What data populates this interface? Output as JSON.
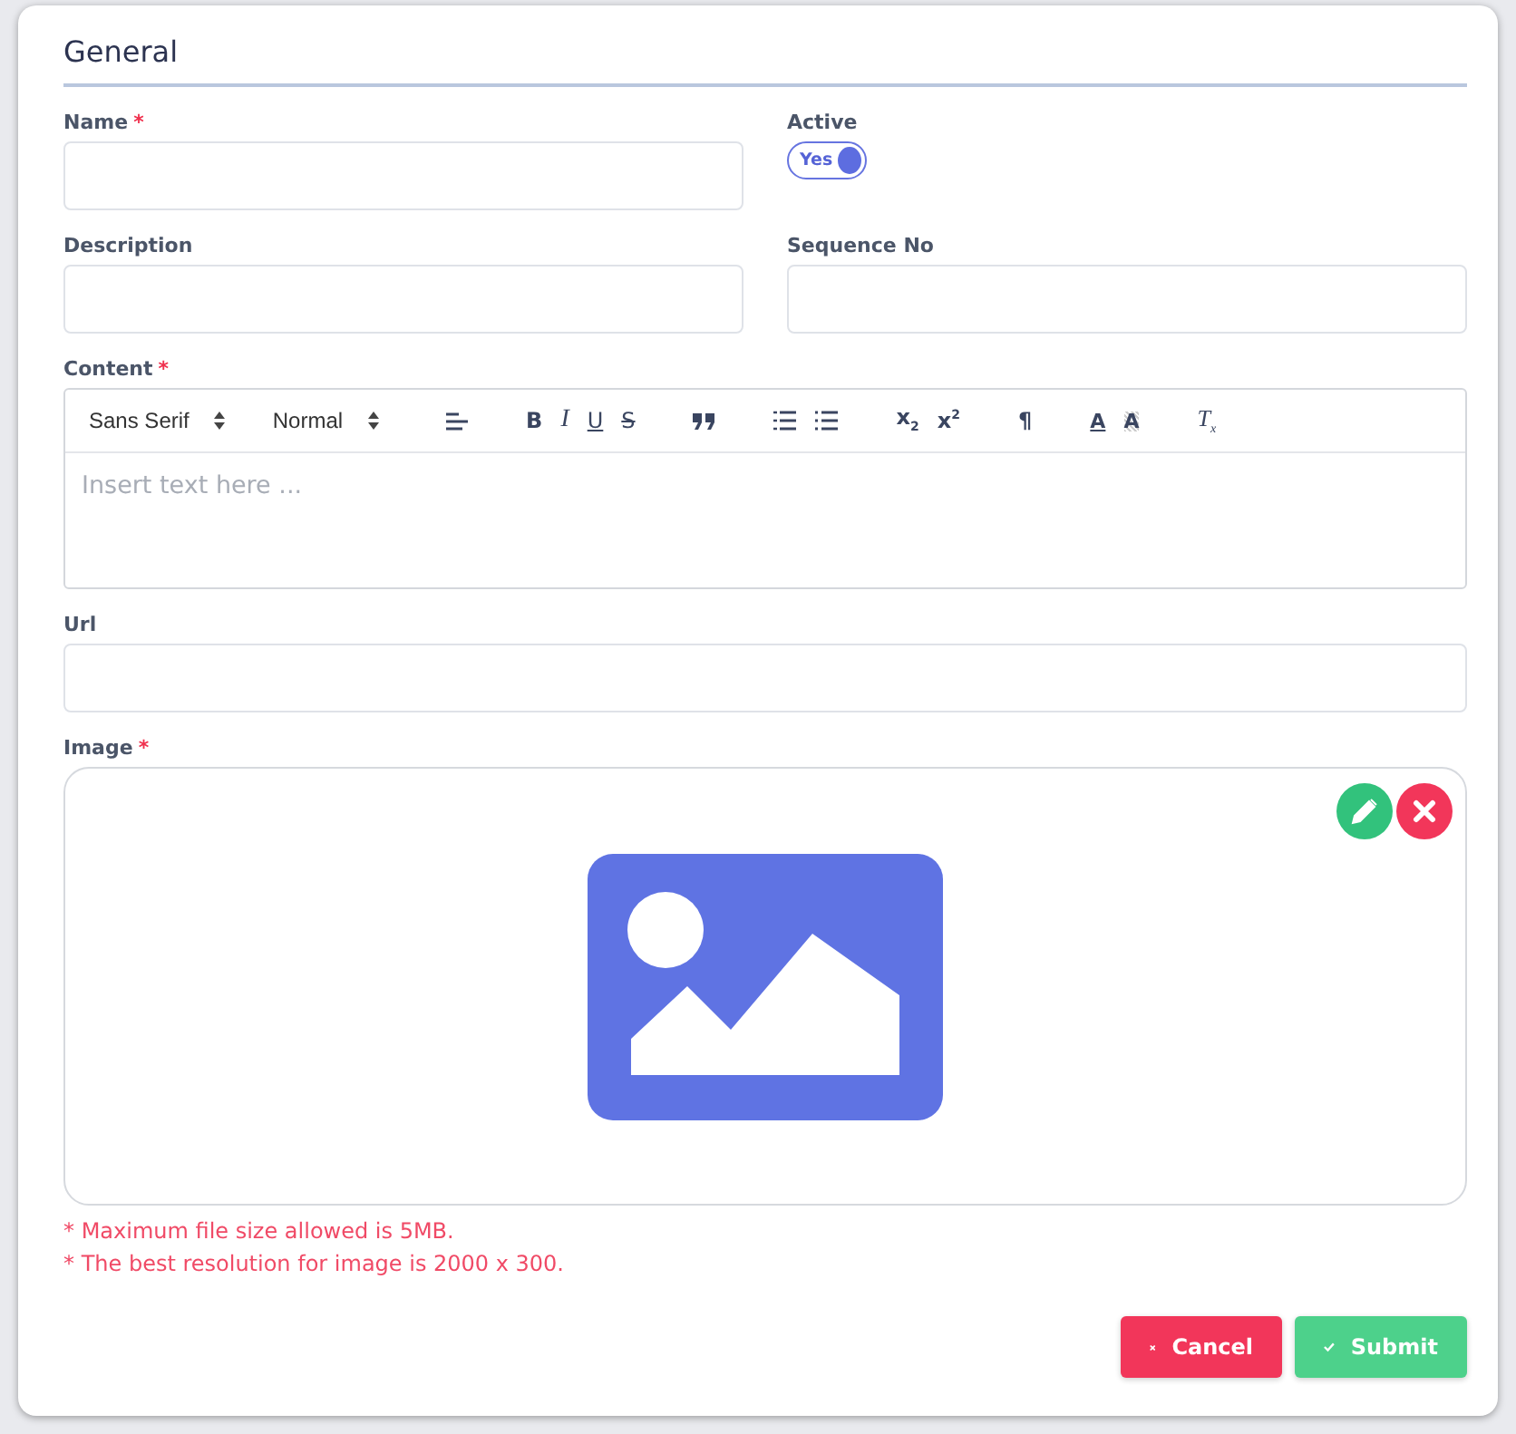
{
  "section": {
    "title": "General"
  },
  "fields": [
    {
      "kind": "text",
      "label": "Name",
      "mark": "*"
    },
    {
      "kind": "toggle",
      "label": "Active",
      "toggle_text": "Yes",
      "on": true
    },
    {
      "kind": "text",
      "label": "Description"
    },
    {
      "kind": "text",
      "label": "Sequence No"
    }
  ],
  "content": {
    "label": "Content",
    "mark": "*",
    "placeholder": "Insert text here ...",
    "toolbar": [
      {
        "kind": "select",
        "label": "Sans Serif"
      },
      {
        "kind": "select",
        "label": "Normal"
      },
      {
        "kind": "align"
      },
      {
        "kind": "bold",
        "label": "B"
      },
      {
        "kind": "italic",
        "label": "I"
      },
      {
        "kind": "underline",
        "label": "U"
      },
      {
        "kind": "strike",
        "label": "S"
      },
      {
        "kind": "quote"
      },
      {
        "kind": "ordered"
      },
      {
        "kind": "bullet"
      },
      {
        "kind": "script",
        "label": "x$_{2}$"
      },
      {
        "kind": "script",
        "label": "x$^{2}$"
      },
      {
        "kind": "direction",
        "label": "¶"
      },
      {
        "kind": "color",
        "label": "A"
      },
      {
        "kind": "background",
        "label": "A"
      },
      {
        "kind": "clean",
        "label": "T$_{x}$"
      }
    ]
  },
  "url": {
    "label": "Url"
  },
  "image": {
    "label": "Image",
    "mark": "*"
  },
  "notes": [
    "* Maximum file size allowed is 5MB.",
    "* The best resolution for image is 2000 x 300."
  ],
  "buttons": [
    {
      "kind": "cancel",
      "label": "Cancel"
    },
    {
      "kind": "submit",
      "label": "Submit"
    }
  ]
}
